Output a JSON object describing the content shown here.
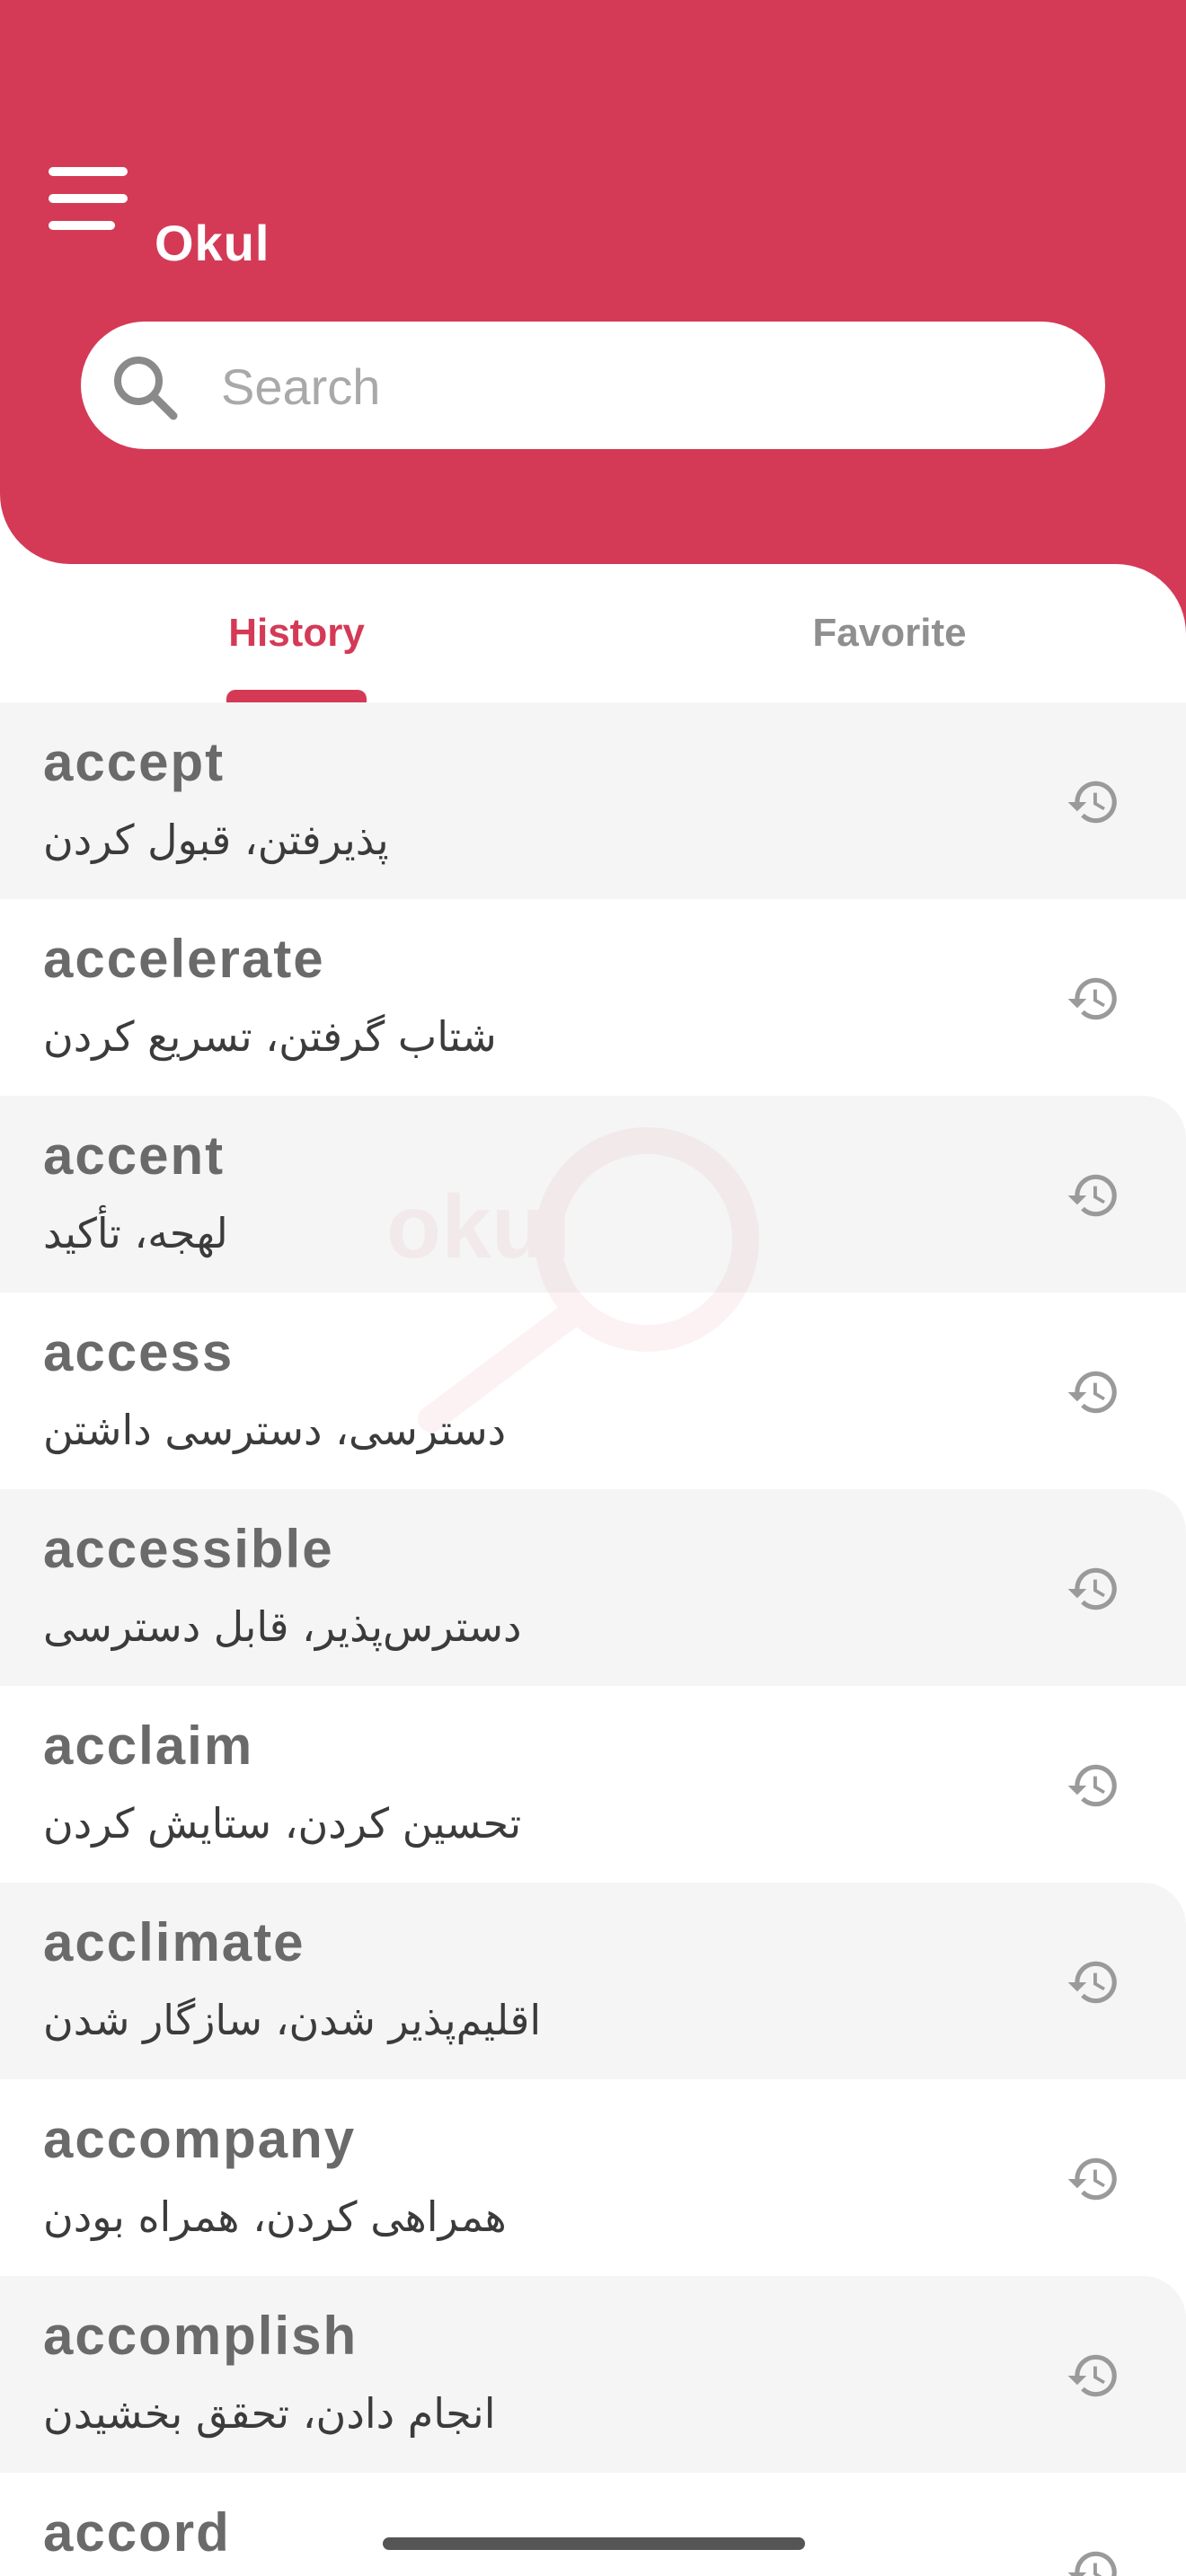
{
  "app": {
    "title": "Okul"
  },
  "search": {
    "placeholder": "Search"
  },
  "tabs": [
    {
      "label": "History",
      "active": true
    },
    {
      "label": "Favorite",
      "active": false
    }
  ],
  "watermark": {
    "text": "okul"
  },
  "colors": {
    "brand": "#d43a56",
    "tab_inactive": "#8f8f8f",
    "word": "#6a6a6a",
    "row_alt": "#f5f5f5"
  },
  "icons": {
    "menu": "hamburger-icon",
    "search": "search-icon",
    "history": "history-icon"
  },
  "history": [
    {
      "word": "accept",
      "meaning": "پذیرفتن، قبول کردن"
    },
    {
      "word": "accelerate",
      "meaning": "شتاب گرفتن، تسریع کردن"
    },
    {
      "word": "accent",
      "meaning": "لهجه، تأکید"
    },
    {
      "word": "access",
      "meaning": "دسترسی، دسترسی داشتن"
    },
    {
      "word": "accessible",
      "meaning": "دسترس‌پذیر، قابل دسترسی"
    },
    {
      "word": "acclaim",
      "meaning": "تحسین کردن، ستایش کردن"
    },
    {
      "word": "acclimate",
      "meaning": "اقلیم‌پذیر شدن، سازگار شدن"
    },
    {
      "word": "accompany",
      "meaning": "همراهی کردن، همراه بودن"
    },
    {
      "word": "accomplish",
      "meaning": "انجام دادن، تحقق بخشیدن"
    },
    {
      "word": "accord",
      "meaning": ""
    }
  ]
}
